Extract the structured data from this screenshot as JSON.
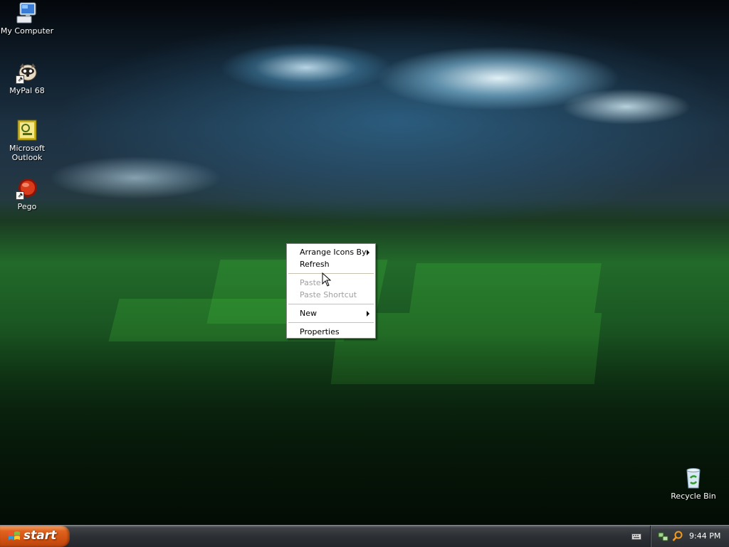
{
  "desktop": {
    "icons": [
      {
        "label": "My Computer",
        "icon": "my-computer-icon"
      },
      {
        "label": "MyPal 68",
        "icon": "mypal-browser-icon"
      },
      {
        "label_line1": "Microsoft",
        "label_line2": "Outlook",
        "icon": "outlook-icon"
      },
      {
        "label": "Pego",
        "icon": "pego-icon"
      },
      {
        "label": "Recycle Bin",
        "icon": "recycle-bin-icon"
      }
    ]
  },
  "context_menu": {
    "items": [
      {
        "label": "Arrange Icons By",
        "has_submenu": true,
        "enabled": true
      },
      {
        "label": "Refresh",
        "has_submenu": false,
        "enabled": true
      },
      {
        "label": "Paste",
        "has_submenu": false,
        "enabled": false
      },
      {
        "label": "Paste Shortcut",
        "has_submenu": false,
        "enabled": false
      },
      {
        "label": "New",
        "has_submenu": true,
        "enabled": true
      },
      {
        "label": "Properties",
        "has_submenu": false,
        "enabled": true
      }
    ]
  },
  "taskbar": {
    "start_label": "start",
    "clock": "9:44 PM",
    "tray_icons": [
      "keyboard-icon",
      "network-icon",
      "search-icon"
    ]
  },
  "colors": {
    "start_button": "#d9581a",
    "taskbar": "#2c3034",
    "menu_disabled_text": "#a0a0a0"
  }
}
